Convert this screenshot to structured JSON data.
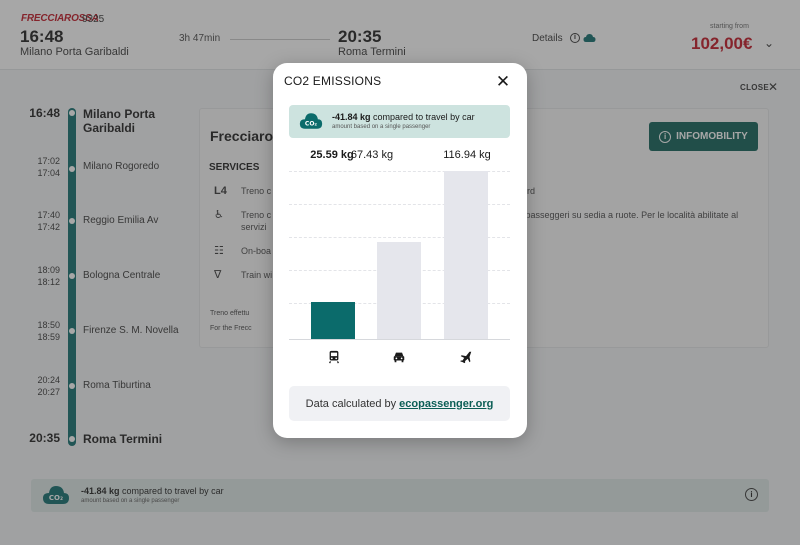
{
  "header": {
    "brand": "FRECCIAROSSA",
    "train_number": "9325",
    "departure_time": "16:48",
    "departure_station": "Milano Porta Garibaldi",
    "duration": "3h 47min",
    "arrival_time": "20:35",
    "arrival_station": "Roma Termini",
    "details_label": "Details",
    "starting_from": "starting from",
    "price": "102,00€"
  },
  "close_label": "CLOSE",
  "stops": [
    {
      "arrival": "16:48",
      "departure": "",
      "name_line1": "Milano Porta",
      "name_line2": "Garibaldi",
      "major": true
    },
    {
      "arrival": "17:02",
      "departure": "17:04",
      "name_line1": "Milano Rogoredo",
      "name_line2": "",
      "major": false
    },
    {
      "arrival": "17:40",
      "departure": "17:42",
      "name_line1": "Reggio Emilia Av",
      "name_line2": "",
      "major": false
    },
    {
      "arrival": "18:09",
      "departure": "18:12",
      "name_line1": "Bologna Centrale",
      "name_line2": "",
      "major": false
    },
    {
      "arrival": "18:50",
      "departure": "18:59",
      "name_line1": "Firenze S. M. Novella",
      "name_line2": "",
      "major": false
    },
    {
      "arrival": "20:24",
      "departure": "20:27",
      "name_line1": "Roma Tiburtina",
      "name_line2": "",
      "major": false
    },
    {
      "arrival": "20:35",
      "departure": "",
      "name_line1": "Roma Termini",
      "name_line2": "",
      "major": true
    }
  ],
  "services_card": {
    "title": "Frecciaros",
    "services_header": "SERVICES",
    "items": [
      {
        "icon": "l4-icon",
        "text": "Treno c",
        "right": "rd"
      },
      {
        "icon": "wheelchair-icon",
        "text": "Treno c",
        "text2": "servizi",
        "right": "r passeggeri su sedia a ruote. Per le località abilitate al"
      },
      {
        "icon": "trolley-icon",
        "text": "On-boa",
        "right": ""
      },
      {
        "icon": "bar-icon",
        "text": "Train wi",
        "right": ""
      }
    ],
    "notes": [
      "Treno effettu",
      "For the Frecc"
    ],
    "infomobility_label": "INFOMOBILITY"
  },
  "bottom_co2": {
    "amount": "-41.84 kg",
    "text": "compared to travel by car",
    "sub": "amount based on a single passenger"
  },
  "modal": {
    "title": "CO2 EMISSIONS",
    "banner_amount": "-41.84 kg",
    "banner_text": "compared to travel by car",
    "banner_sub": "amount based on a single passenger",
    "source_prefix": "Data calculated by",
    "source_link": "ecopassenger.org"
  },
  "chart_data": {
    "type": "bar",
    "categories": [
      "train",
      "car",
      "plane"
    ],
    "labels": [
      "25.59 kg",
      "67.43 kg",
      "116.94 kg"
    ],
    "values": [
      25.59,
      67.43,
      116.94
    ],
    "ylim": [
      0,
      117
    ],
    "grid": true,
    "colors": {
      "active": "#0b6b6b",
      "inactive": "#e5e6ec"
    }
  },
  "colors": {
    "accent": "#0b6b6b",
    "price": "#c1121f",
    "banner": "#cde3df"
  }
}
